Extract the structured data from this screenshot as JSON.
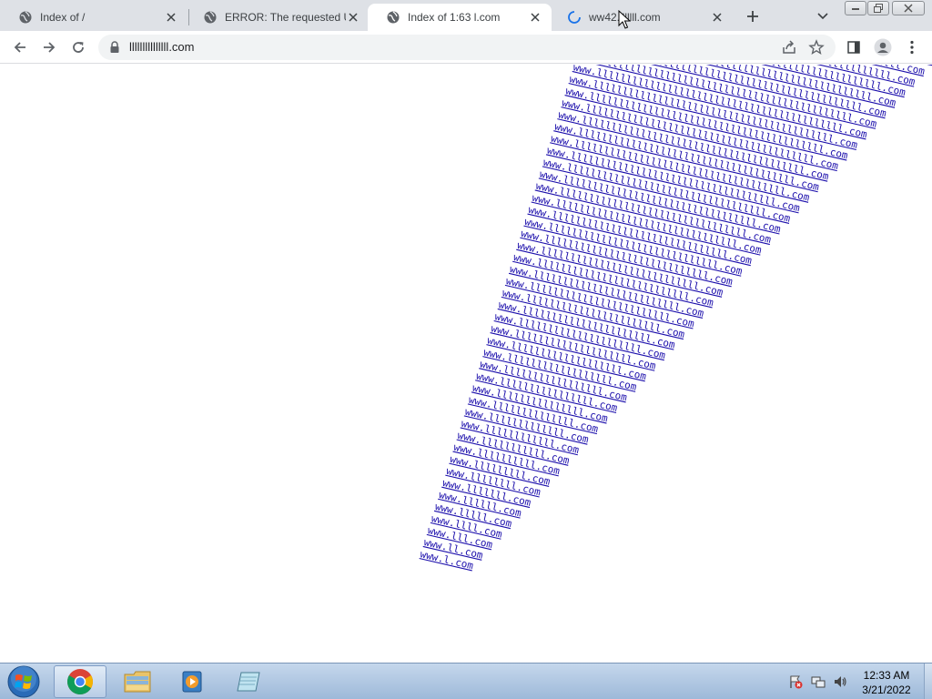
{
  "tabs": [
    {
      "title": "Index of /",
      "active": false
    },
    {
      "title": "ERROR: The requested URL",
      "active": false
    },
    {
      "title": "Index of 1:63 l.com",
      "active": true
    },
    {
      "title": "ww42.lllllll.com",
      "active": false,
      "loading": true
    }
  ],
  "toolbar": {
    "url": "lllllllllllllll.com"
  },
  "page": {
    "links": [
      "www.l.com",
      "www.ll.com",
      "www.lll.com",
      "www.llll.com",
      "www.lllll.com",
      "www.llllll.com",
      "www.lllllll.com",
      "www.llllllll.com",
      "www.lllllllll.com",
      "www.llllllllll.com",
      "www.lllllllllll.com",
      "www.llllllllllll.com",
      "www.lllllllllllll.com",
      "www.llllllllllllll.com",
      "www.lllllllllllllll.com",
      "www.llllllllllllllll.com",
      "www.lllllllllllllllll.com",
      "www.llllllllllllllllll.com",
      "www.lllllllllllllllllll.com",
      "www.llllllllllllllllllll.com",
      "www.lllllllllllllllllllll.com",
      "www.llllllllllllllllllllll.com",
      "www.lllllllllllllllllllllll.com",
      "www.llllllllllllllllllllllll.com",
      "www.lllllllllllllllllllllllll.com",
      "www.llllllllllllllllllllllllll.com",
      "www.lllllllllllllllllllllllllll.com",
      "www.llllllllllllllllllllllllllll.com",
      "www.lllllllllllllllllllllllllllll.com",
      "www.llllllllllllllllllllllllllllll.com",
      "www.lllllllllllllllllllllllllllllll.com",
      "www.llllllllllllllllllllllllllllllll.com",
      "www.lllllllllllllllllllllllllllllllll.com",
      "www.llllllllllllllllllllllllllllllllll.com",
      "www.lllllllllllllllllllllllllllllllllll.com",
      "www.llllllllllllllllllllllllllllllllllll.com",
      "www.lllllllllllllllllllllllllllllllllllll.com",
      "www.llllllllllllllllllllllllllllllllllllll.com",
      "www.lllllllllllllllllllllllllllllllllllllll.com",
      "www.llllllllllllllllllllllllllllllllllllllll.com",
      "www.lllllllllllllllllllllllllllllllllllllllll.com",
      "www.llllllllllllllllllllllllllllllllllllllllll.com",
      "www.lllllllllllllllllllllllllllllllllllllllllll.com",
      "www.llllllllllllllllllllllllllllllllllllllllllll.com",
      "www.lllllllllllllllllllllllllllllllllllllllllllll.com",
      "www.llllllllllllllllllllllllllllllllllllllllllllll.com",
      "www.lllllllllllllllllllllllllllllllllllllllllllllll.com",
      "www.llllllllllllllllllllllllllllllllllllllllllllllll.com",
      "www.lllllllllllllllllllllllllllllllllllllllllllllllll.com",
      "www.llllllllllllllllllllllllllllllllllllllllllllllllll.com",
      "www.lllllllllllllllllllllllllllllllllllllllllllllllllll.com",
      "www.llllllllllllllllllllllllllllllllllllllllllllllllllll.com",
      "www.lllllllllllllllllllllllllllllllllllllllllllllllllllll.com",
      "www.llllllllllllllllllllllllllllllllllllllllllllllllllllll.com",
      "www.lllllllllllllllllllllllllllllllllllllllllllllllllllllll.com"
    ]
  },
  "taskbar": {
    "apps": [
      "chrome",
      "file-explorer",
      "media-player",
      "notepad"
    ],
    "time": "12:33 AM",
    "date": "3/21/2022"
  },
  "colors": {
    "link": "#1a0dab",
    "tabstrip": "#dee1e6",
    "taskbar": "#b3c9e3"
  }
}
